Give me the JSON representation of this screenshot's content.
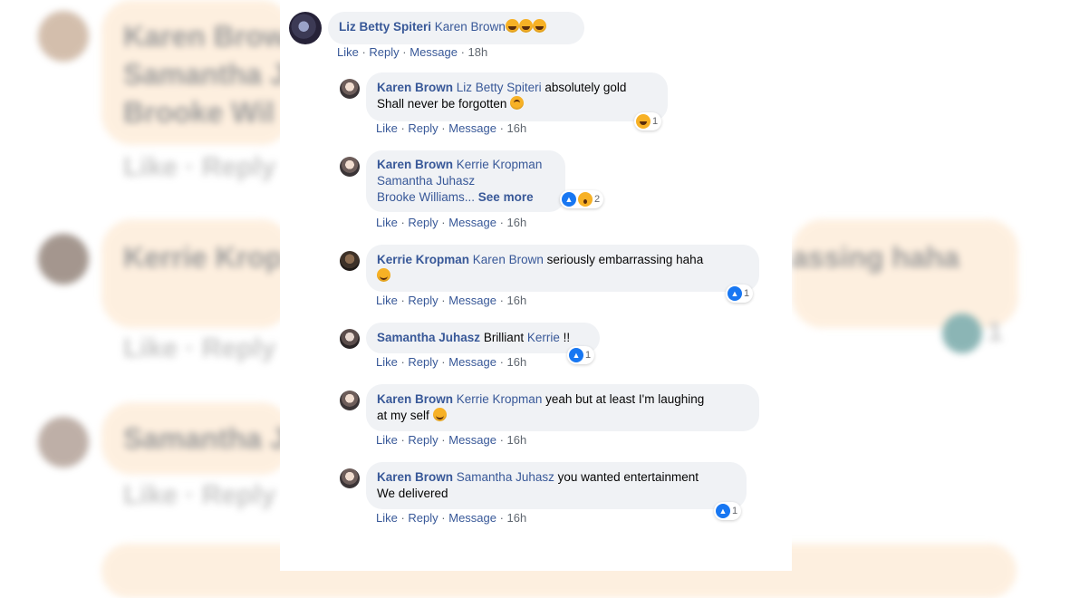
{
  "meta_sep": " · ",
  "background": {
    "rows": [
      {
        "text": "Karen Brow",
        "sub1": "Samantha J",
        "sub2": "Brooke Wil",
        "meta": "Like · Reply"
      },
      {
        "text": "Kerrie Krop",
        "right": "assing haha",
        "meta": "Like · Reply",
        "count": "1"
      },
      {
        "text": "Samantha J",
        "meta": "Like · Reply"
      }
    ]
  },
  "comments": [
    {
      "author": "Liz Betty Spiteri",
      "mention": "Karen Brown",
      "lines": [],
      "actions": {
        "like": "Like",
        "reply": "Reply",
        "message": "Message",
        "time": "18h"
      }
    },
    {
      "author": "Karen Brown",
      "mention": "Liz Betty Spiteri",
      "text": "absolutely gold",
      "line2": "Shall never be forgotten",
      "reaction_count": "1",
      "actions": {
        "like": "Like",
        "reply": "Reply",
        "message": "Message",
        "time": "16h"
      }
    },
    {
      "author": "Karen Brown",
      "mention": "Kerrie Kropman",
      "line2": "Samantha Juhasz",
      "line3": "Brooke Williams...",
      "see_more": "See more",
      "reaction_count": "2",
      "actions": {
        "like": "Like",
        "reply": "Reply",
        "message": "Message",
        "time": "16h"
      }
    },
    {
      "author": "Kerrie Kropman",
      "mention": "Karen Brown",
      "text": "seriously embarrassing haha",
      "reaction_count": "1",
      "actions": {
        "like": "Like",
        "reply": "Reply",
        "message": "Message",
        "time": "16h"
      }
    },
    {
      "author": "Samantha Juhasz",
      "text": "Brilliant",
      "mention": "Kerrie",
      "suffix": "!!",
      "reaction_count": "1",
      "actions": {
        "like": "Like",
        "reply": "Reply",
        "message": "Message",
        "time": "16h"
      }
    },
    {
      "author": "Karen Brown",
      "mention": "Kerrie Kropman",
      "text": "yeah but at least I'm laughing",
      "line2": "at my self",
      "actions": {
        "like": "Like",
        "reply": "Reply",
        "message": "Message",
        "time": "16h"
      }
    },
    {
      "author": "Karen Brown",
      "mention": "Samantha Juhasz",
      "text": "you wanted entertainment",
      "line2": "We delivered",
      "reaction_count": "1",
      "actions": {
        "like": "Like",
        "reply": "Reply",
        "message": "Message",
        "time": "16h"
      }
    }
  ]
}
